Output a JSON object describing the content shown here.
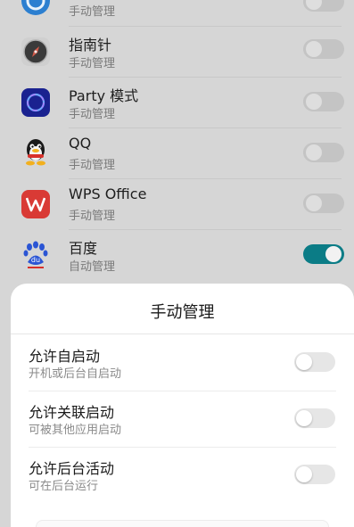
{
  "apps": [
    {
      "name": "",
      "sub": "手动管理",
      "icon": "browser-icon",
      "enabled": false
    },
    {
      "name": "指南针",
      "sub": "手动管理",
      "icon": "compass-icon",
      "enabled": false
    },
    {
      "name": "Party 模式",
      "sub": "手动管理",
      "icon": "party-mode-icon",
      "enabled": false
    },
    {
      "name": "QQ",
      "sub": "手动管理",
      "icon": "qq-penguin-icon",
      "enabled": false
    },
    {
      "name": "WPS Office",
      "sub": "手动管理",
      "icon": "wps-office-icon",
      "enabled": false
    },
    {
      "name": "百度",
      "sub": "自动管理",
      "icon": "baidu-paw-icon",
      "enabled": true
    }
  ],
  "sheet": {
    "title": "手动管理",
    "options": [
      {
        "label": "允许自启动",
        "sub": "开机或后台自启动",
        "enabled": false
      },
      {
        "label": "允许关联启动",
        "sub": "可被其他应用启动",
        "enabled": false
      },
      {
        "label": "允许后台活动",
        "sub": "可在后台运行",
        "enabled": false
      }
    ]
  },
  "colors": {
    "toggle_on": "#0b7c86",
    "wps_red": "#d93a35",
    "party_bg": "#1a2290",
    "baidu_blue": "#2b55d4"
  }
}
